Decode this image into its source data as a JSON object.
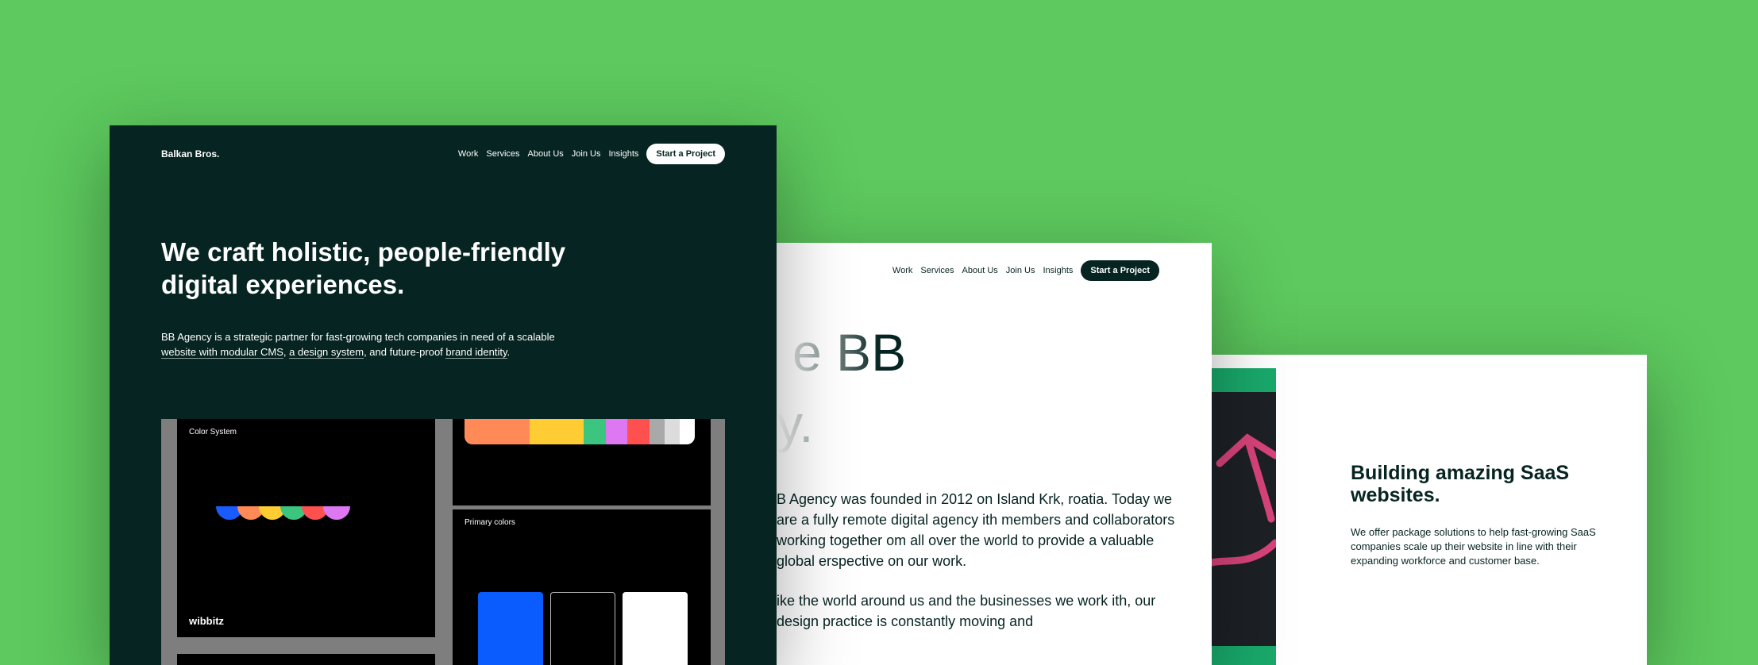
{
  "dark_site": {
    "brand": "Balkan Bros.",
    "nav": [
      "Work",
      "Services",
      "About Us",
      "Join Us",
      "Insights"
    ],
    "cta": "Start a Project",
    "hero_title": "We craft holistic, people-friendly digital experiences.",
    "intro": {
      "part1": "BB Agency is a strategic partner for fast-growing tech companies in need of a scalable ",
      "link1": "website with modular CMS",
      "part2": ", ",
      "link2": "a design system",
      "part3": ", and future-proof ",
      "link3": "brand identity",
      "part4": "."
    },
    "showcase": {
      "color_system_label": "Color System",
      "wibbitz_label": "wibbitz",
      "primary_colors_label": "Primary colors",
      "semicircle_colors": [
        "#1a5bff",
        "#ff8a57",
        "#ffcc33",
        "#3cc57e",
        "#ff5050",
        "#dd77f2"
      ],
      "strip_colors": [
        "#ff8a57",
        "#ffcc33",
        "#3cc57e",
        "#dd77f2",
        "#ff5050",
        "#a9a9a9",
        "#dcdcdc",
        "#ffffff"
      ],
      "primary_colors": [
        "#0a5cff",
        "#000000",
        "#ffffff"
      ]
    }
  },
  "about_site": {
    "nav": [
      "Work",
      "Services",
      "About Us",
      "Join Us",
      "Insights"
    ],
    "cta": "Start a Project",
    "title_line1": "e BB",
    "title_line2": "y.",
    "paragraph1": "B Agency was founded in 2012 on Island Krk, roatia. Today we are a fully remote digital agency ith members and collaborators working together om all over the world to provide a valuable global erspective on our work.",
    "paragraph2": "ike the world around us and the businesses we work ith, our design practice is constantly moving and"
  },
  "saas_site": {
    "title": "Building amazing SaaS websites.",
    "body": "We offer package solutions to help fast-growing SaaS companies scale up their website in line with their expanding workforce and customer base."
  }
}
